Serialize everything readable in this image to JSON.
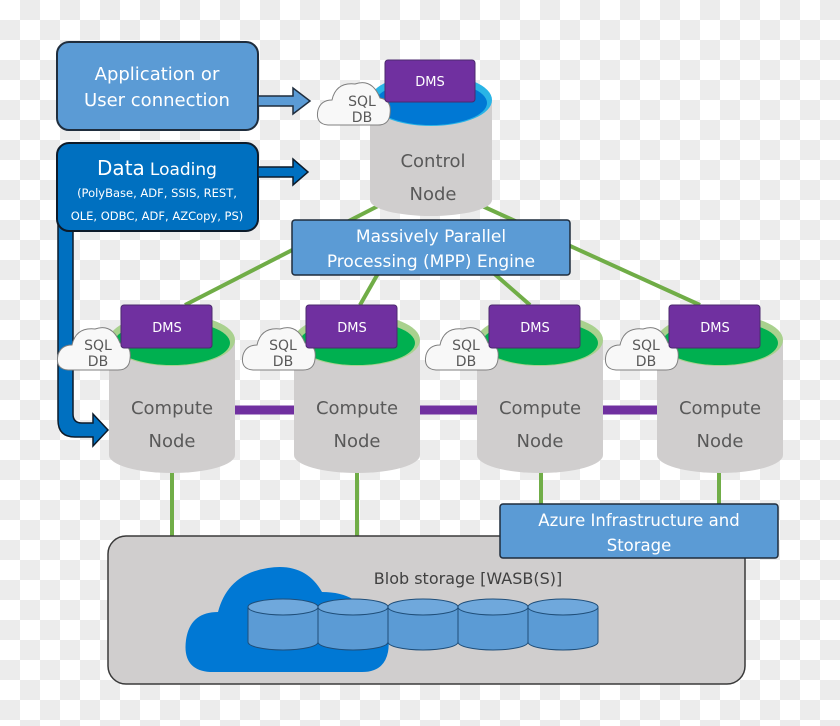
{
  "app_box": {
    "line1": "Application or",
    "line2": "User connection"
  },
  "data_box": {
    "title_big": "Data",
    "title_small": "Loading",
    "line2": "(PolyBase, ADF, SSIS, REST,",
    "line3": "OLE, ODBC, ADF, AZCopy, PS)"
  },
  "control_node": {
    "line1": "Control",
    "line2": "Node",
    "dms": "DMS",
    "sql1": "SQL",
    "sql2": "DB"
  },
  "mpp": {
    "line1": "Massively Parallel",
    "line2": "Processing (MPP) Engine"
  },
  "compute_nodes": [
    {
      "line1": "Compute",
      "line2": "Node",
      "dms": "DMS",
      "sql1": "SQL",
      "sql2": "DB"
    },
    {
      "line1": "Compute",
      "line2": "Node",
      "dms": "DMS",
      "sql1": "SQL",
      "sql2": "DB"
    },
    {
      "line1": "Compute",
      "line2": "Node",
      "dms": "DMS",
      "sql1": "SQL",
      "sql2": "DB"
    },
    {
      "line1": "Compute",
      "line2": "Node",
      "dms": "DMS",
      "sql1": "SQL",
      "sql2": "DB"
    }
  ],
  "azure": {
    "line1": "Azure Infrastructure and",
    "line2": "Storage"
  },
  "blob": {
    "label": "Blob storage [WASB(S)]"
  },
  "colors": {
    "light_blue": "#5b9bd5",
    "dark_blue": "#0070c0",
    "purple": "#7030a0",
    "green": "#70ad47",
    "node_top_green": "#00b050",
    "cylinder_gray": "#d0cece"
  }
}
